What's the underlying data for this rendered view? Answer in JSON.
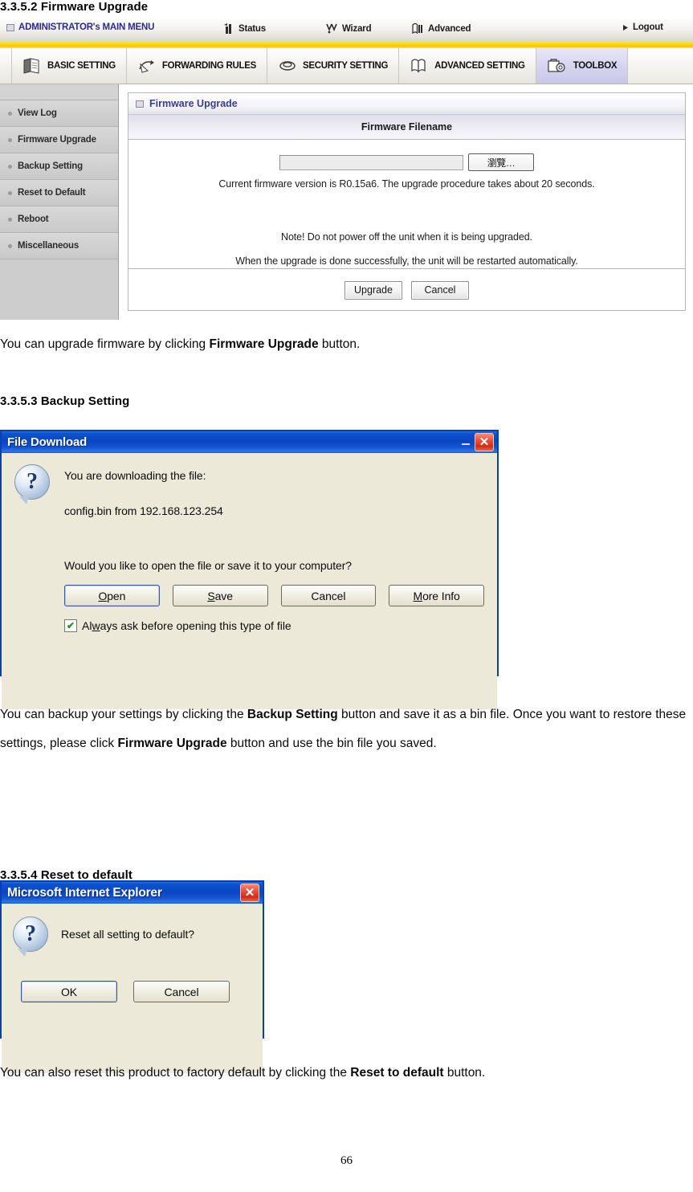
{
  "document": {
    "headings": {
      "firmware_upgrade": "3.3.5.2 Firmware Upgrade",
      "backup_setting": "3.3.5.3 Backup Setting",
      "reset_to_default": "3.3.5.4 Reset to default"
    },
    "paragraphs": {
      "firmware": {
        "part1": "You can upgrade firmware by clicking ",
        "bold1": "Firmware Upgrade",
        "part2": " button."
      },
      "backup": {
        "part1": "You can backup your settings by clicking the ",
        "bold1": "Backup Setting",
        "part2": " button and save it as a bin file. Once you want to restore these settings, please click ",
        "bold2": "Firmware Upgrade",
        "part3": " button and use the bin file you saved."
      },
      "reset": {
        "part1": "You can also reset this product to factory default by clicking the ",
        "bold1": "Reset to default",
        "part2": " button."
      }
    },
    "page_number": "66"
  },
  "router": {
    "topbar": {
      "main_menu": "ADMINISTRATOR's MAIN MENU",
      "status": "Status",
      "wizard": "Wizard",
      "advanced": "Advanced",
      "logout": "Logout"
    },
    "tabs": [
      {
        "label": "BASIC SETTING",
        "icon": "book-pages-icon",
        "active": false
      },
      {
        "label": "FORWARDING RULES",
        "icon": "arrows-forward-icon",
        "active": false
      },
      {
        "label": "SECURITY SETTING",
        "icon": "shield-hex-icon",
        "active": false
      },
      {
        "label": "ADVANCED SETTING",
        "icon": "open-book-icon",
        "active": false
      },
      {
        "label": "TOOLBOX",
        "icon": "toolbox-gear-icon",
        "active": true
      }
    ],
    "sidebar": {
      "items": [
        {
          "label": "View Log"
        },
        {
          "label": "Firmware Upgrade"
        },
        {
          "label": "Backup Setting"
        },
        {
          "label": "Reset to Default"
        },
        {
          "label": "Reboot"
        },
        {
          "label": "Miscellaneous"
        }
      ]
    },
    "panel": {
      "title": "Firmware Upgrade",
      "column_header": "Firmware Filename",
      "file_input_value": "",
      "browse_button": "瀏覽…",
      "note_version": "Current firmware version is R0.15a6. The upgrade procedure takes about 20 seconds.",
      "note_power": "Note! Do not power off the unit when it is being upgraded.",
      "note_restart": "When the upgrade is done successfully, the unit will be restarted automatically.",
      "upgrade_button": "Upgrade",
      "cancel_button": "Cancel"
    }
  },
  "file_download_dialog": {
    "title": "File Download",
    "close_label": "✕",
    "line1": "You are downloading the file:",
    "line2": "config.bin from 192.168.123.254",
    "question": "Would you like to open the file or save it to your computer?",
    "buttons": {
      "open": "Open",
      "save": "Save",
      "cancel": "Cancel",
      "more_info": "More Info"
    },
    "checkbox_label": "Always ask before opening this type of file",
    "checkbox_checked": "✔",
    "icon": "question-mark-balloon-icon"
  },
  "ie_dialog": {
    "title": "Microsoft Internet Explorer",
    "close_label": "✕",
    "message": "Reset all setting to default?",
    "buttons": {
      "ok": "OK",
      "cancel": "Cancel"
    },
    "icon": "question-mark-balloon-icon"
  },
  "colors": {
    "title_bar_blue": "#0a46c4",
    "dialog_face": "#ece9d8",
    "router_accent_yellow": "#ffd400",
    "router_menu_purple": "#2c2b8c",
    "active_tab_lavender": "#c8c7e8",
    "close_button_red": "#cf2d19"
  }
}
